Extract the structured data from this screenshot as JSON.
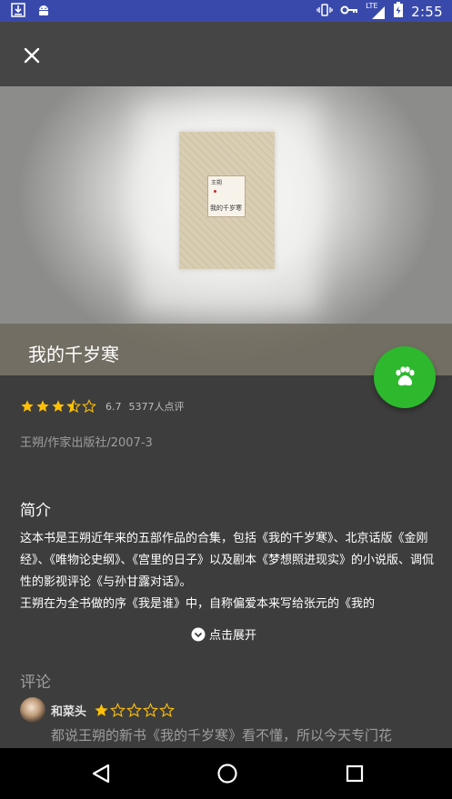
{
  "status_bar": {
    "time": "2:55",
    "network": "LTE",
    "icons": [
      "download-icon",
      "android-icon",
      "vibrate-icon",
      "vpn-key-icon",
      "signal-icon",
      "battery-icon"
    ]
  },
  "toolbar": {
    "close_icon": "close-icon"
  },
  "book": {
    "title": "我的千岁寒",
    "cover": {
      "author": "王朔",
      "title": "我的千岁寒"
    },
    "rating_stars": 3.5,
    "rating_score": "6.7",
    "rating_count": "5377人点评",
    "meta": "王朔/作家出版社/2007-3"
  },
  "fab": {
    "icon": "paw-icon",
    "color": "#2eb82e"
  },
  "intro": {
    "title": "简介",
    "paragraphs": [
      "这本书是王朔近年来的五部作品的合集，包括《我的千岁寒》、北京话版《金刚经》、《唯物论史纲》、《宫里的日子》以及剧本《梦想照进现实》的小说版、调侃性的影视评论《与孙甘露对话》。",
      "王朔在为全书做的序《我是谁》中，自称偏爱本来写给张元的《我的"
    ],
    "expand_label": "点击展开"
  },
  "comments": {
    "title": "评论",
    "items": [
      {
        "author": "和菜头",
        "stars": 1,
        "text": "都说王朔的新书《我的千岁寒》看不懂，所以今天专门花"
      }
    ]
  },
  "colors": {
    "status_bar": "#3949ab",
    "toolbar": "#454545",
    "background": "#3d3d3d",
    "star": "#ffc107"
  },
  "nav": {
    "icons": [
      "back-icon",
      "home-icon",
      "recents-icon"
    ]
  }
}
